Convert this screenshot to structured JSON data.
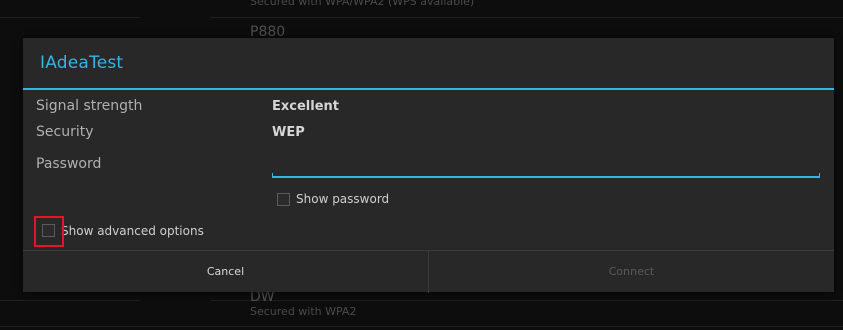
{
  "background_list": {
    "top_item_sub": "Secured with WPA/WPA2 (WPS available)",
    "item_p880_title": "P880",
    "item_dw_title": "DW",
    "item_dw_sub": "Secured with WPA2"
  },
  "dialog": {
    "title": "IAdeaTest",
    "signal_label": "Signal strength",
    "signal_value": "Excellent",
    "security_label": "Security",
    "security_value": "WEP",
    "password_label": "Password",
    "password_value": "",
    "show_password_label": "Show password",
    "show_advanced_label": "Show advanced options",
    "cancel_label": "Cancel",
    "connect_label": "Connect"
  },
  "colors": {
    "accent": "#33b5e5",
    "highlight": "#e8132b"
  }
}
